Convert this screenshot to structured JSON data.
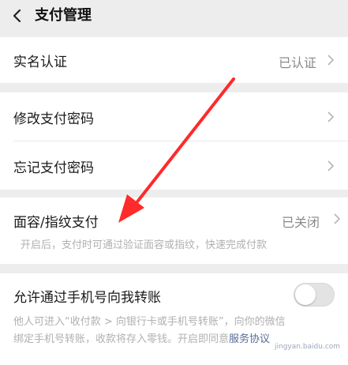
{
  "header": {
    "title": "支付管理",
    "back_icon": "chevron-left-icon"
  },
  "realname": {
    "label": "实名认证",
    "value": "已认证"
  },
  "change_password": {
    "label": "修改支付密码"
  },
  "forget_password": {
    "label": "忘记支付密码"
  },
  "biometric": {
    "label": "面容/指纹支付",
    "value": "已关闭",
    "description": "开启后，支付时可通过验证面容或指纹，快速完成付款"
  },
  "phone_transfer": {
    "label": "允许通过手机号向我转账",
    "toggle_on": false,
    "description_line1": "他人可进入“收付款 > 向银行卡或手机号转账”，向你的微信",
    "description_line2_prefix": "绑定手机号转账，收款将存入零钱。开启即同意",
    "link": "服务协议"
  },
  "watermark": {
    "text": "jingyan.baidu.com"
  },
  "colors": {
    "annotation_arrow": "#ff2a2a",
    "link": "#576b95"
  }
}
